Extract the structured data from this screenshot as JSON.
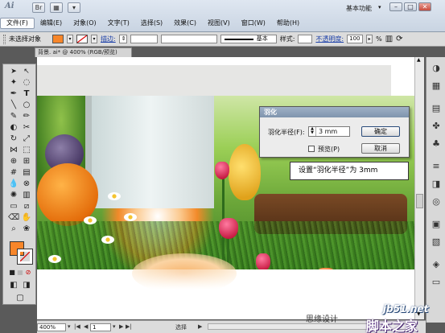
{
  "app": {
    "logo": "Ai",
    "workspace": "基本功能"
  },
  "menu": [
    "文件(F)",
    "编辑(E)",
    "对象(O)",
    "文字(T)",
    "选择(S)",
    "效果(C)",
    "视图(V)",
    "窗口(W)",
    "帮助(H)"
  ],
  "control_bar": {
    "selection": "未选择对象",
    "stroke_label": "描边:",
    "stroke_style": "基本",
    "style_label": "样式:",
    "opacity_label": "不透明度:",
    "opacity_value": "100",
    "opacity_unit": "%"
  },
  "document": {
    "tab_title": "背景. ai* @ 400% (RGB/预览)"
  },
  "dialog": {
    "title": "羽化",
    "radius_label": "羽化半径(F):",
    "radius_value": "3 mm",
    "preview_label": "预览(P)",
    "ok_label": "确定",
    "cancel_label": "取消"
  },
  "callout": "设置“羽化半径”为 3mm",
  "status_bar": {
    "zoom": "400%",
    "page": "1",
    "mode": "选择"
  },
  "watermark": {
    "left_text": "思缘设计",
    "site": "jb51.net",
    "name": "脚本之家"
  },
  "colors": {
    "fill_swatch": "#f7862a",
    "title_blue": "#7f94ad"
  }
}
